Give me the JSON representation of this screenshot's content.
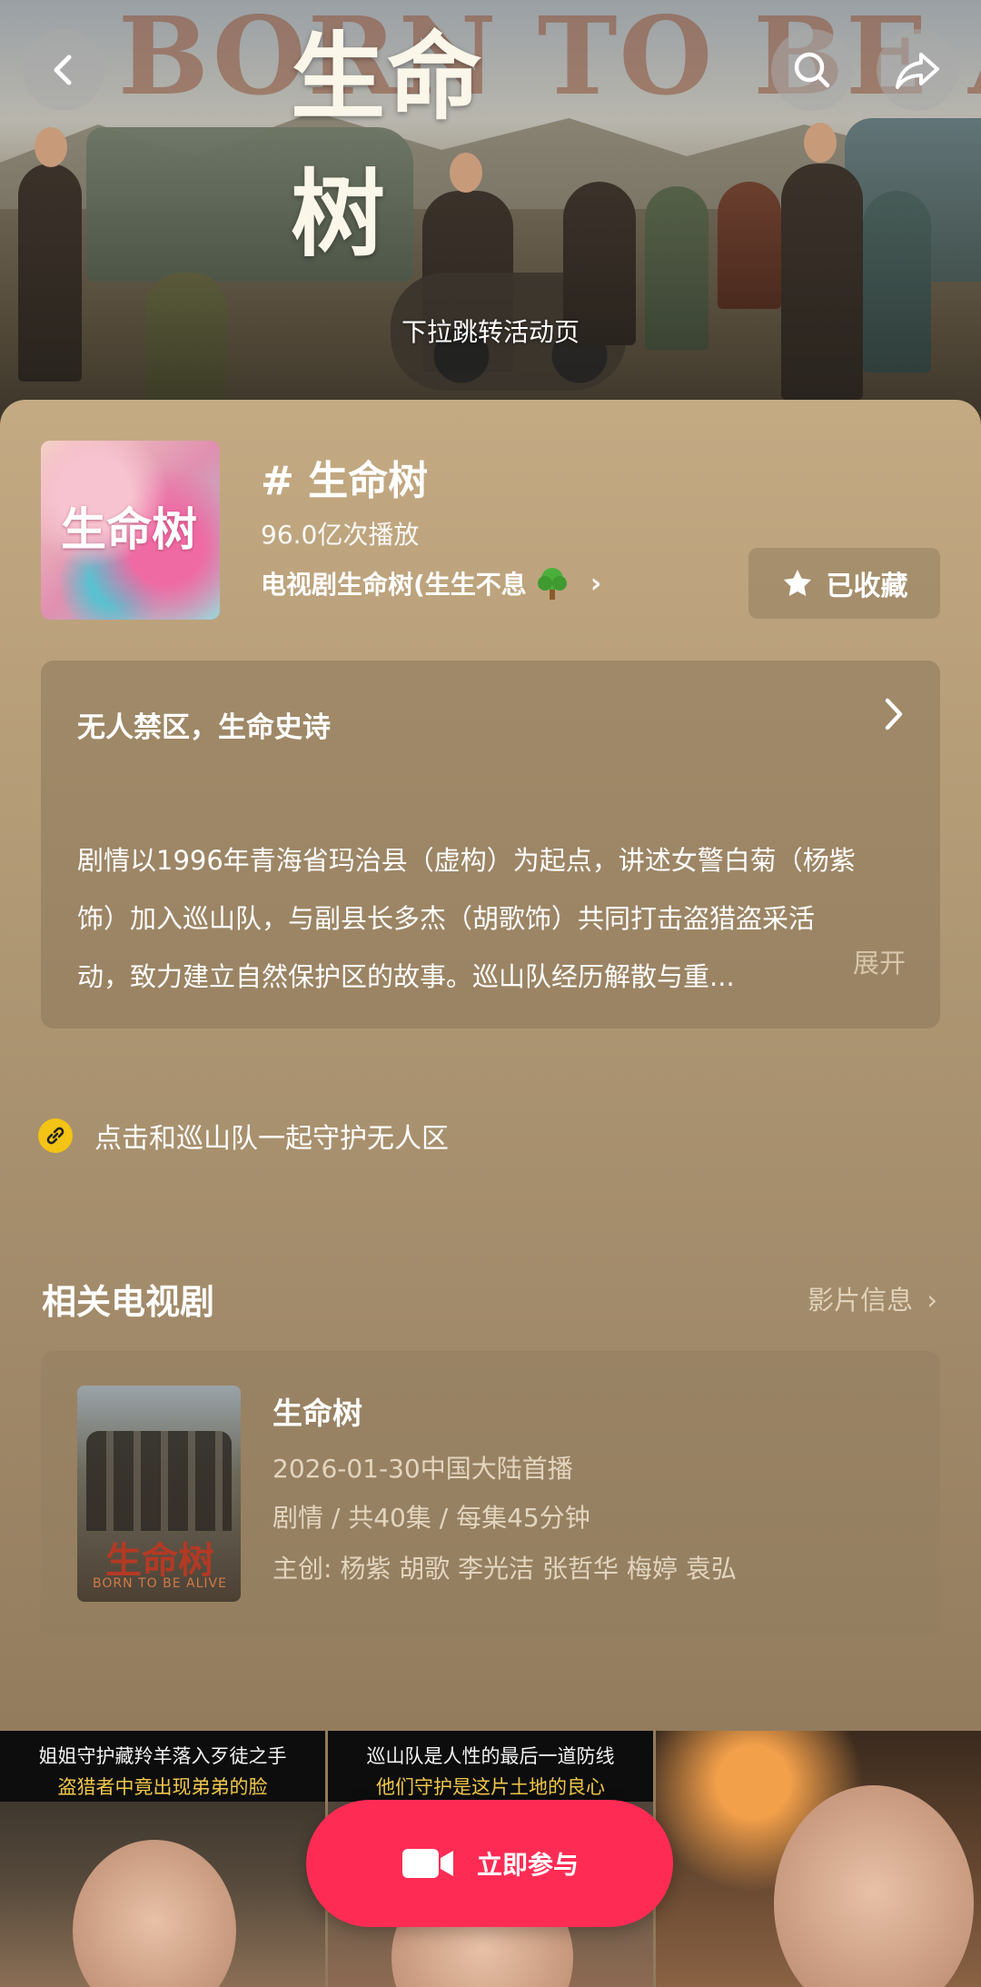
{
  "hero": {
    "title_en": "BORN TO BE ALIVE",
    "title_cn": "生命树",
    "pull_hint": "下拉跳转活动页",
    "back_icon": "back-icon",
    "search_icon": "search-icon",
    "share_icon": "share-icon"
  },
  "topic": {
    "cover_text": "生命树",
    "title": "# 生命树",
    "plays": "96.0亿次播放",
    "series_label": "电视剧生命树(生生不息",
    "favorite_label": "已收藏"
  },
  "description": {
    "heading": "无人禁区，生命史诗",
    "lines": [
      "剧情以1996年青海省玛治县（虚构）为起点，讲述女警白菊（杨紫",
      "饰）加入巡山队，与副县长多杰（胡歌饰）共同打击盗猎盗采活",
      "动，致力建立自然保护区的故事。巡山队经历解散与重..."
    ],
    "expand_label": "展开"
  },
  "link_row": {
    "label": "点击和巡山队一起守护无人区"
  },
  "related": {
    "section_title": "相关电视剧",
    "info_link": "影片信息",
    "drama": {
      "poster_title": "生命树",
      "poster_subtitle": "BORN TO BE ALIVE",
      "name": "生命树",
      "premiere": "2026-01-30中国大陆首播",
      "meta": "剧情 / 共40集 / 每集45分钟",
      "cast": "主创: 杨紫 胡歌 李光洁 张哲华 梅婷 袁弘"
    }
  },
  "videos": [
    {
      "line1": "姐姐守护藏羚羊落入歹徒之手",
      "line2": "盗猎者中竟出现弟弟的脸"
    },
    {
      "line1": "巡山队是人性的最后一道防线",
      "line2": "他们守护是这片土地的良心"
    },
    {
      "line1": "",
      "line2": ""
    }
  ],
  "join_button": {
    "label": "立即参与"
  },
  "colors": {
    "accent": "#fe2c55",
    "link_badge": "#f3c315"
  }
}
